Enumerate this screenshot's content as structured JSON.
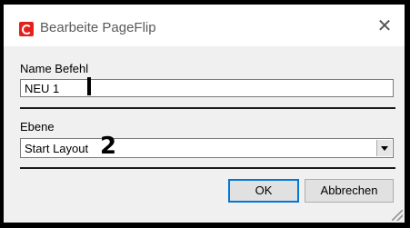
{
  "window": {
    "title": "Bearbeite PageFlip",
    "close_glyph": "✕"
  },
  "form": {
    "name_label": "Name Befehl",
    "name_value": "NEU 1",
    "layer_label": "Ebene",
    "layer_value": "Start Layout"
  },
  "annotations": {
    "two": "2"
  },
  "buttons": {
    "ok": "OK",
    "cancel": "Abbrechen"
  }
}
